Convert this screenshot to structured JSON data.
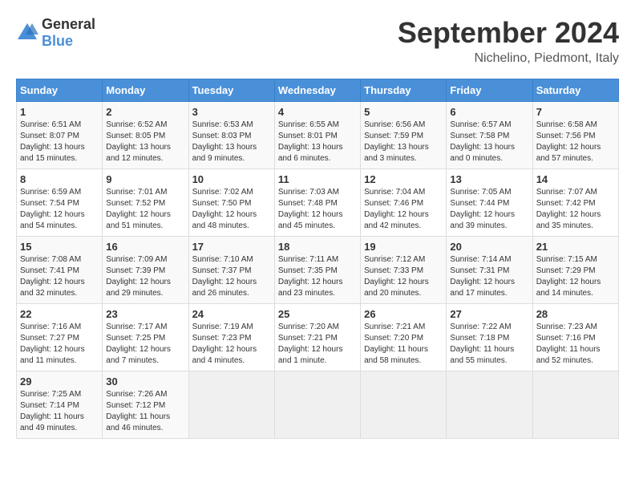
{
  "logo": {
    "text_general": "General",
    "text_blue": "Blue"
  },
  "title": {
    "month_year": "September 2024",
    "location": "Nichelino, Piedmont, Italy"
  },
  "calendar": {
    "headers": [
      "Sunday",
      "Monday",
      "Tuesday",
      "Wednesday",
      "Thursday",
      "Friday",
      "Saturday"
    ],
    "weeks": [
      [
        {
          "day": "1",
          "sunrise": "Sunrise: 6:51 AM",
          "sunset": "Sunset: 8:07 PM",
          "daylight": "Daylight: 13 hours and 15 minutes."
        },
        {
          "day": "2",
          "sunrise": "Sunrise: 6:52 AM",
          "sunset": "Sunset: 8:05 PM",
          "daylight": "Daylight: 13 hours and 12 minutes."
        },
        {
          "day": "3",
          "sunrise": "Sunrise: 6:53 AM",
          "sunset": "Sunset: 8:03 PM",
          "daylight": "Daylight: 13 hours and 9 minutes."
        },
        {
          "day": "4",
          "sunrise": "Sunrise: 6:55 AM",
          "sunset": "Sunset: 8:01 PM",
          "daylight": "Daylight: 13 hours and 6 minutes."
        },
        {
          "day": "5",
          "sunrise": "Sunrise: 6:56 AM",
          "sunset": "Sunset: 7:59 PM",
          "daylight": "Daylight: 13 hours and 3 minutes."
        },
        {
          "day": "6",
          "sunrise": "Sunrise: 6:57 AM",
          "sunset": "Sunset: 7:58 PM",
          "daylight": "Daylight: 13 hours and 0 minutes."
        },
        {
          "day": "7",
          "sunrise": "Sunrise: 6:58 AM",
          "sunset": "Sunset: 7:56 PM",
          "daylight": "Daylight: 12 hours and 57 minutes."
        }
      ],
      [
        {
          "day": "8",
          "sunrise": "Sunrise: 6:59 AM",
          "sunset": "Sunset: 7:54 PM",
          "daylight": "Daylight: 12 hours and 54 minutes."
        },
        {
          "day": "9",
          "sunrise": "Sunrise: 7:01 AM",
          "sunset": "Sunset: 7:52 PM",
          "daylight": "Daylight: 12 hours and 51 minutes."
        },
        {
          "day": "10",
          "sunrise": "Sunrise: 7:02 AM",
          "sunset": "Sunset: 7:50 PM",
          "daylight": "Daylight: 12 hours and 48 minutes."
        },
        {
          "day": "11",
          "sunrise": "Sunrise: 7:03 AM",
          "sunset": "Sunset: 7:48 PM",
          "daylight": "Daylight: 12 hours and 45 minutes."
        },
        {
          "day": "12",
          "sunrise": "Sunrise: 7:04 AM",
          "sunset": "Sunset: 7:46 PM",
          "daylight": "Daylight: 12 hours and 42 minutes."
        },
        {
          "day": "13",
          "sunrise": "Sunrise: 7:05 AM",
          "sunset": "Sunset: 7:44 PM",
          "daylight": "Daylight: 12 hours and 39 minutes."
        },
        {
          "day": "14",
          "sunrise": "Sunrise: 7:07 AM",
          "sunset": "Sunset: 7:42 PM",
          "daylight": "Daylight: 12 hours and 35 minutes."
        }
      ],
      [
        {
          "day": "15",
          "sunrise": "Sunrise: 7:08 AM",
          "sunset": "Sunset: 7:41 PM",
          "daylight": "Daylight: 12 hours and 32 minutes."
        },
        {
          "day": "16",
          "sunrise": "Sunrise: 7:09 AM",
          "sunset": "Sunset: 7:39 PM",
          "daylight": "Daylight: 12 hours and 29 minutes."
        },
        {
          "day": "17",
          "sunrise": "Sunrise: 7:10 AM",
          "sunset": "Sunset: 7:37 PM",
          "daylight": "Daylight: 12 hours and 26 minutes."
        },
        {
          "day": "18",
          "sunrise": "Sunrise: 7:11 AM",
          "sunset": "Sunset: 7:35 PM",
          "daylight": "Daylight: 12 hours and 23 minutes."
        },
        {
          "day": "19",
          "sunrise": "Sunrise: 7:12 AM",
          "sunset": "Sunset: 7:33 PM",
          "daylight": "Daylight: 12 hours and 20 minutes."
        },
        {
          "day": "20",
          "sunrise": "Sunrise: 7:14 AM",
          "sunset": "Sunset: 7:31 PM",
          "daylight": "Daylight: 12 hours and 17 minutes."
        },
        {
          "day": "21",
          "sunrise": "Sunrise: 7:15 AM",
          "sunset": "Sunset: 7:29 PM",
          "daylight": "Daylight: 12 hours and 14 minutes."
        }
      ],
      [
        {
          "day": "22",
          "sunrise": "Sunrise: 7:16 AM",
          "sunset": "Sunset: 7:27 PM",
          "daylight": "Daylight: 12 hours and 11 minutes."
        },
        {
          "day": "23",
          "sunrise": "Sunrise: 7:17 AM",
          "sunset": "Sunset: 7:25 PM",
          "daylight": "Daylight: 12 hours and 7 minutes."
        },
        {
          "day": "24",
          "sunrise": "Sunrise: 7:19 AM",
          "sunset": "Sunset: 7:23 PM",
          "daylight": "Daylight: 12 hours and 4 minutes."
        },
        {
          "day": "25",
          "sunrise": "Sunrise: 7:20 AM",
          "sunset": "Sunset: 7:21 PM",
          "daylight": "Daylight: 12 hours and 1 minute."
        },
        {
          "day": "26",
          "sunrise": "Sunrise: 7:21 AM",
          "sunset": "Sunset: 7:20 PM",
          "daylight": "Daylight: 11 hours and 58 minutes."
        },
        {
          "day": "27",
          "sunrise": "Sunrise: 7:22 AM",
          "sunset": "Sunset: 7:18 PM",
          "daylight": "Daylight: 11 hours and 55 minutes."
        },
        {
          "day": "28",
          "sunrise": "Sunrise: 7:23 AM",
          "sunset": "Sunset: 7:16 PM",
          "daylight": "Daylight: 11 hours and 52 minutes."
        }
      ],
      [
        {
          "day": "29",
          "sunrise": "Sunrise: 7:25 AM",
          "sunset": "Sunset: 7:14 PM",
          "daylight": "Daylight: 11 hours and 49 minutes."
        },
        {
          "day": "30",
          "sunrise": "Sunrise: 7:26 AM",
          "sunset": "Sunset: 7:12 PM",
          "daylight": "Daylight: 11 hours and 46 minutes."
        },
        {
          "day": "",
          "sunrise": "",
          "sunset": "",
          "daylight": ""
        },
        {
          "day": "",
          "sunrise": "",
          "sunset": "",
          "daylight": ""
        },
        {
          "day": "",
          "sunrise": "",
          "sunset": "",
          "daylight": ""
        },
        {
          "day": "",
          "sunrise": "",
          "sunset": "",
          "daylight": ""
        },
        {
          "day": "",
          "sunrise": "",
          "sunset": "",
          "daylight": ""
        }
      ]
    ]
  }
}
